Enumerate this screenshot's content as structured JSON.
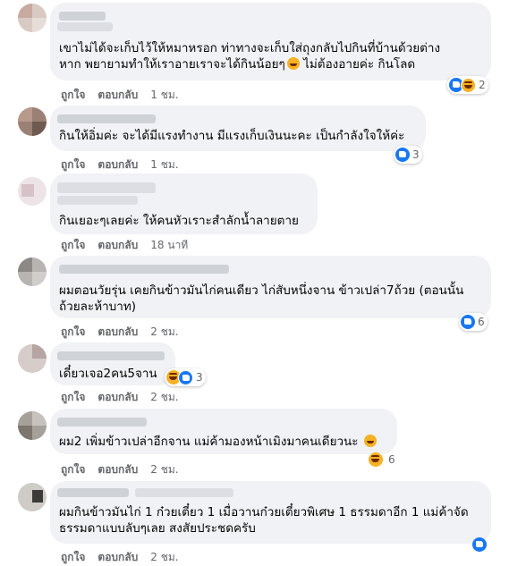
{
  "ui": {
    "like_label": "ถูกใจ",
    "reply_label": "ตอบกลับ"
  },
  "comments": [
    {
      "name": "",
      "text": "เขาไม่ได้จะเก็บไว้ให้หมาหรอก ท่าทางจะเก็บใส่ถุงกลับไปกินที่บ้านด้วยต่าง\nหาก พยายามทำให้เราอายเราจะได้กินน้อยๆ",
      "text_tail": "ไม่ต้องอายค่ะ กินโลด",
      "time": "1 ชม.",
      "reaction_icons": [
        "like-icon",
        "haha-icon"
      ],
      "reaction_count": "2"
    },
    {
      "name": "",
      "text": "กินให้อิ่มค่ะ จะได้มีแรงทำงาน มีแรงเก็บเงินนะคะ เป็นกำลังใจให้ค่ะ",
      "time": "1 ชม.",
      "reaction_icons": [
        "like-icon"
      ],
      "reaction_count": "3"
    },
    {
      "name": "",
      "text": "กินเยอะๆเลยค่ะ ให้คนหัวเราะสำลักน้ำลายตาย",
      "time": "18 นาที",
      "reaction_icons": [],
      "reaction_count": ""
    },
    {
      "name": "",
      "text": "ผมตอนวัยรุ่น เคยกินข้าวมันไก่คนเดียว ไก่สับหนึ่งจาน ข้าวเปล่า7ถ้วย (ตอนนั้น\nถ้วยละห้าบาท)",
      "time": "2 ชม.",
      "reaction_icons": [
        "like-icon"
      ],
      "reaction_count": "6"
    },
    {
      "name": "",
      "text": "เดี๋ยวเจอ2คน5จาน",
      "time": "2 ชม.",
      "reaction_icons": [
        "haha-icon",
        "like-icon"
      ],
      "reaction_count": "3"
    },
    {
      "name": "",
      "text": "ผม2 เพิ่มข้าวเปล่าอีกจาน แม่ค้ามองหน้าเมิงมาคนเดียวนะ",
      "time": "2 ชม.",
      "reaction_icons": [
        "haha-icon"
      ],
      "reaction_count": "6"
    },
    {
      "name": "",
      "text": "ผมกินข้าวมันไก่ 1 ก๋วยเตี๋ยว 1 เมื่อวานก๋วยเตี๋ยวพิเศษ 1 ธรรมดาอีก 1 แม่ค้าจัด\nธรรมดาแบบลับๆเลย สงสัยประชดครับ",
      "time": "2 ชม.",
      "reaction_icons": [
        "like-icon"
      ],
      "reaction_count": ""
    }
  ]
}
